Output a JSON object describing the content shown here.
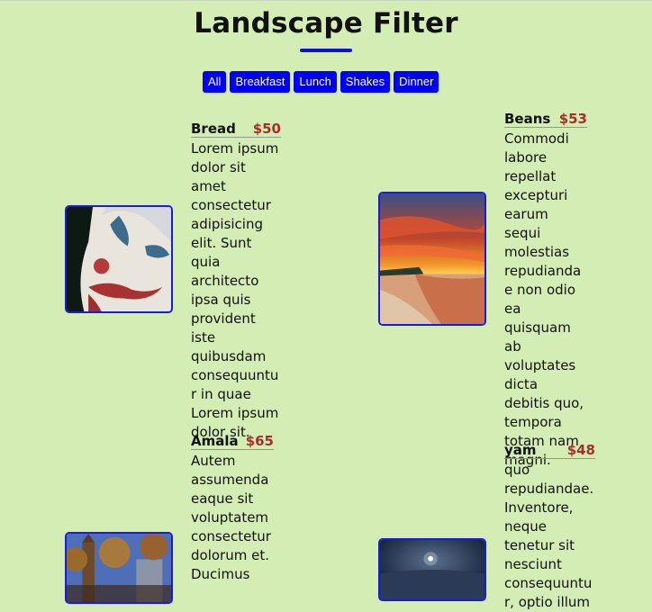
{
  "page": {
    "title": "Landscape Filter"
  },
  "filters": [
    "All",
    "Breakfast",
    "Lunch",
    "Shakes",
    "Dinner"
  ],
  "items": [
    {
      "name": "Bread",
      "price": "$50",
      "desc": "Lorem ipsum dolor sit amet consectetur adipisicing elit. Sunt quia architecto ipsa quis provident iste quibusdam consequuntur in quae Lorem ipsum dolor sit.",
      "image": "clown-face"
    },
    {
      "name": "Beans",
      "price": "$53",
      "desc": "Commodi labore repellat excepturi earum sequi molestias repudiandae non odio ea quisquam ab voluptates dicta debitis quo, tempora totam nam magni.",
      "image": "sunset-beach"
    },
    {
      "name": "Amala",
      "price": "$65",
      "desc": "Autem assumenda eaque sit voluptatem consectetur dolorum et. Ducimus",
      "image": "city-tower"
    },
    {
      "name": "yam",
      "price": "$48",
      "desc": "quo repudiandae. Inventore, neque tenetur sit nesciunt consequuntur, optio illum",
      "image": "moon-night"
    }
  ]
}
